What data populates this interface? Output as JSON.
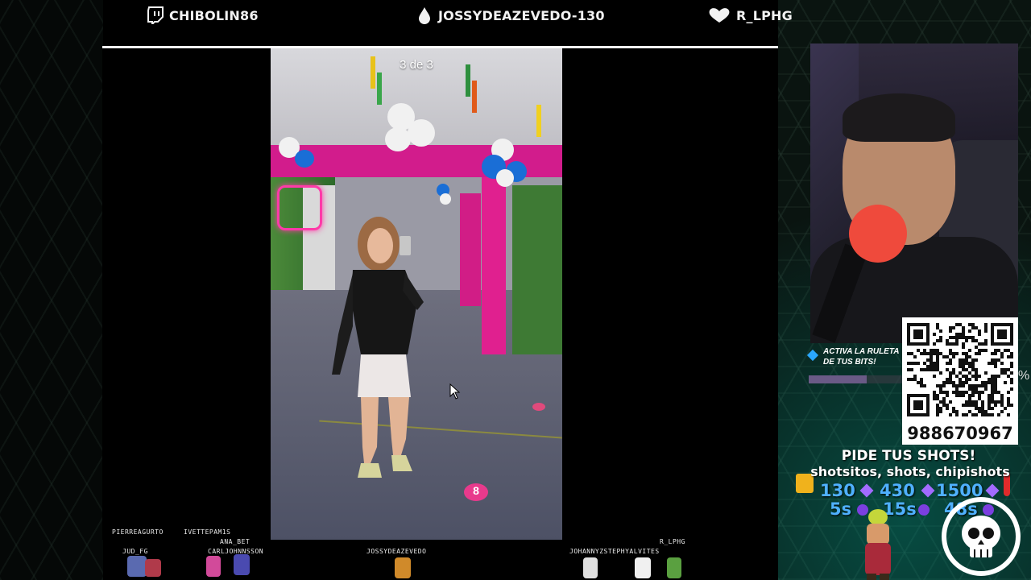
{
  "top_bar": {
    "socials": [
      {
        "icon": "twitch-icon",
        "handle": "CHIBOLIN86"
      },
      {
        "icon": "drop-icon",
        "handle": "JOSSYDEAZEVEDO-130"
      },
      {
        "icon": "heart-hands-icon",
        "handle": "R_LPHG"
      }
    ]
  },
  "story": {
    "counter": "3 de 3",
    "floor_marker": "8"
  },
  "widgets": {
    "roulette_text": "ACTIVA LA RULETA DE TUS BITS!",
    "percent_sign": "%",
    "qr_number": "988670967",
    "shots_title": "PIDE TUS SHOTS!",
    "shots_sub": "shotsitos, shots, chipishots",
    "prices": [
      "130",
      "430",
      "1500"
    ],
    "durations": [
      "5s",
      "15s",
      "48s"
    ]
  },
  "chat_crowd": {
    "names": [
      "PIERREAGURTO",
      "IVETTEPAM1S",
      "ANA_BET",
      "JUD_FG",
      "CARLJOHNNSSON",
      "JOSSYDEAZEVEDO",
      "JOHANNYZSTEPHYALVITES",
      "R_LPHG"
    ]
  },
  "colors": {
    "accent_blue": "#4fb0ff",
    "gem_purple": "#a26bff",
    "pink": "#e0208f"
  }
}
